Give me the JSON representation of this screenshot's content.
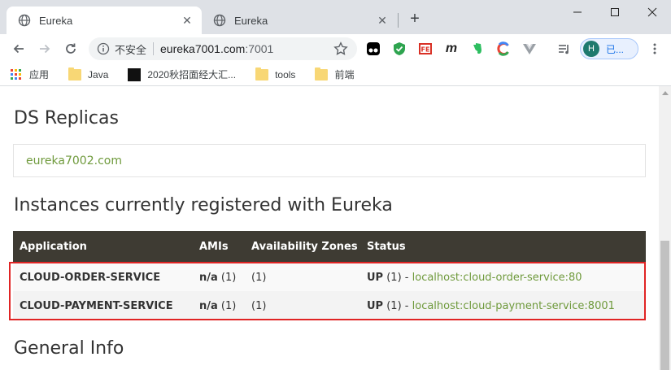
{
  "tabs": [
    {
      "title": "Eureka",
      "active": true
    },
    {
      "title": "Eureka",
      "active": false
    }
  ],
  "toolbar": {
    "security_label": "不安全",
    "url_host": "eureka7001.com",
    "url_port": ":7001",
    "profile_initial": "H",
    "profile_label": "已..."
  },
  "bookmarks": [
    {
      "label": "应用",
      "icon": "apps-grid-icon"
    },
    {
      "label": "Java",
      "icon": "folder-icon"
    },
    {
      "label": "2020秋招面经大汇...",
      "icon": "site-favicon"
    },
    {
      "label": "tools",
      "icon": "folder-icon"
    },
    {
      "label": "前端",
      "icon": "folder-icon"
    }
  ],
  "page": {
    "replicas_heading": "DS Replicas",
    "replica": "eureka7002.com",
    "instances_heading": "Instances currently registered with Eureka",
    "general_heading": "General Info",
    "columns": [
      "Application",
      "AMIs",
      "Availability Zones",
      "Status"
    ],
    "rows": [
      {
        "app": "CLOUD-ORDER-SERVICE",
        "ami": "n/a",
        "ami_count": "(1)",
        "zones": "(1)",
        "status": "UP",
        "status_count": "(1) -",
        "instance": "localhost:cloud-order-service:80"
      },
      {
        "app": "CLOUD-PAYMENT-SERVICE",
        "ami": "n/a",
        "ami_count": "(1)",
        "zones": "(1)",
        "status": "UP",
        "status_count": "(1) -",
        "instance": "localhost:cloud-payment-service:8001"
      }
    ]
  },
  "colors": {
    "link": "#6f9a3c",
    "table_header": "#3e3b33",
    "highlight_border": "#e02424"
  }
}
